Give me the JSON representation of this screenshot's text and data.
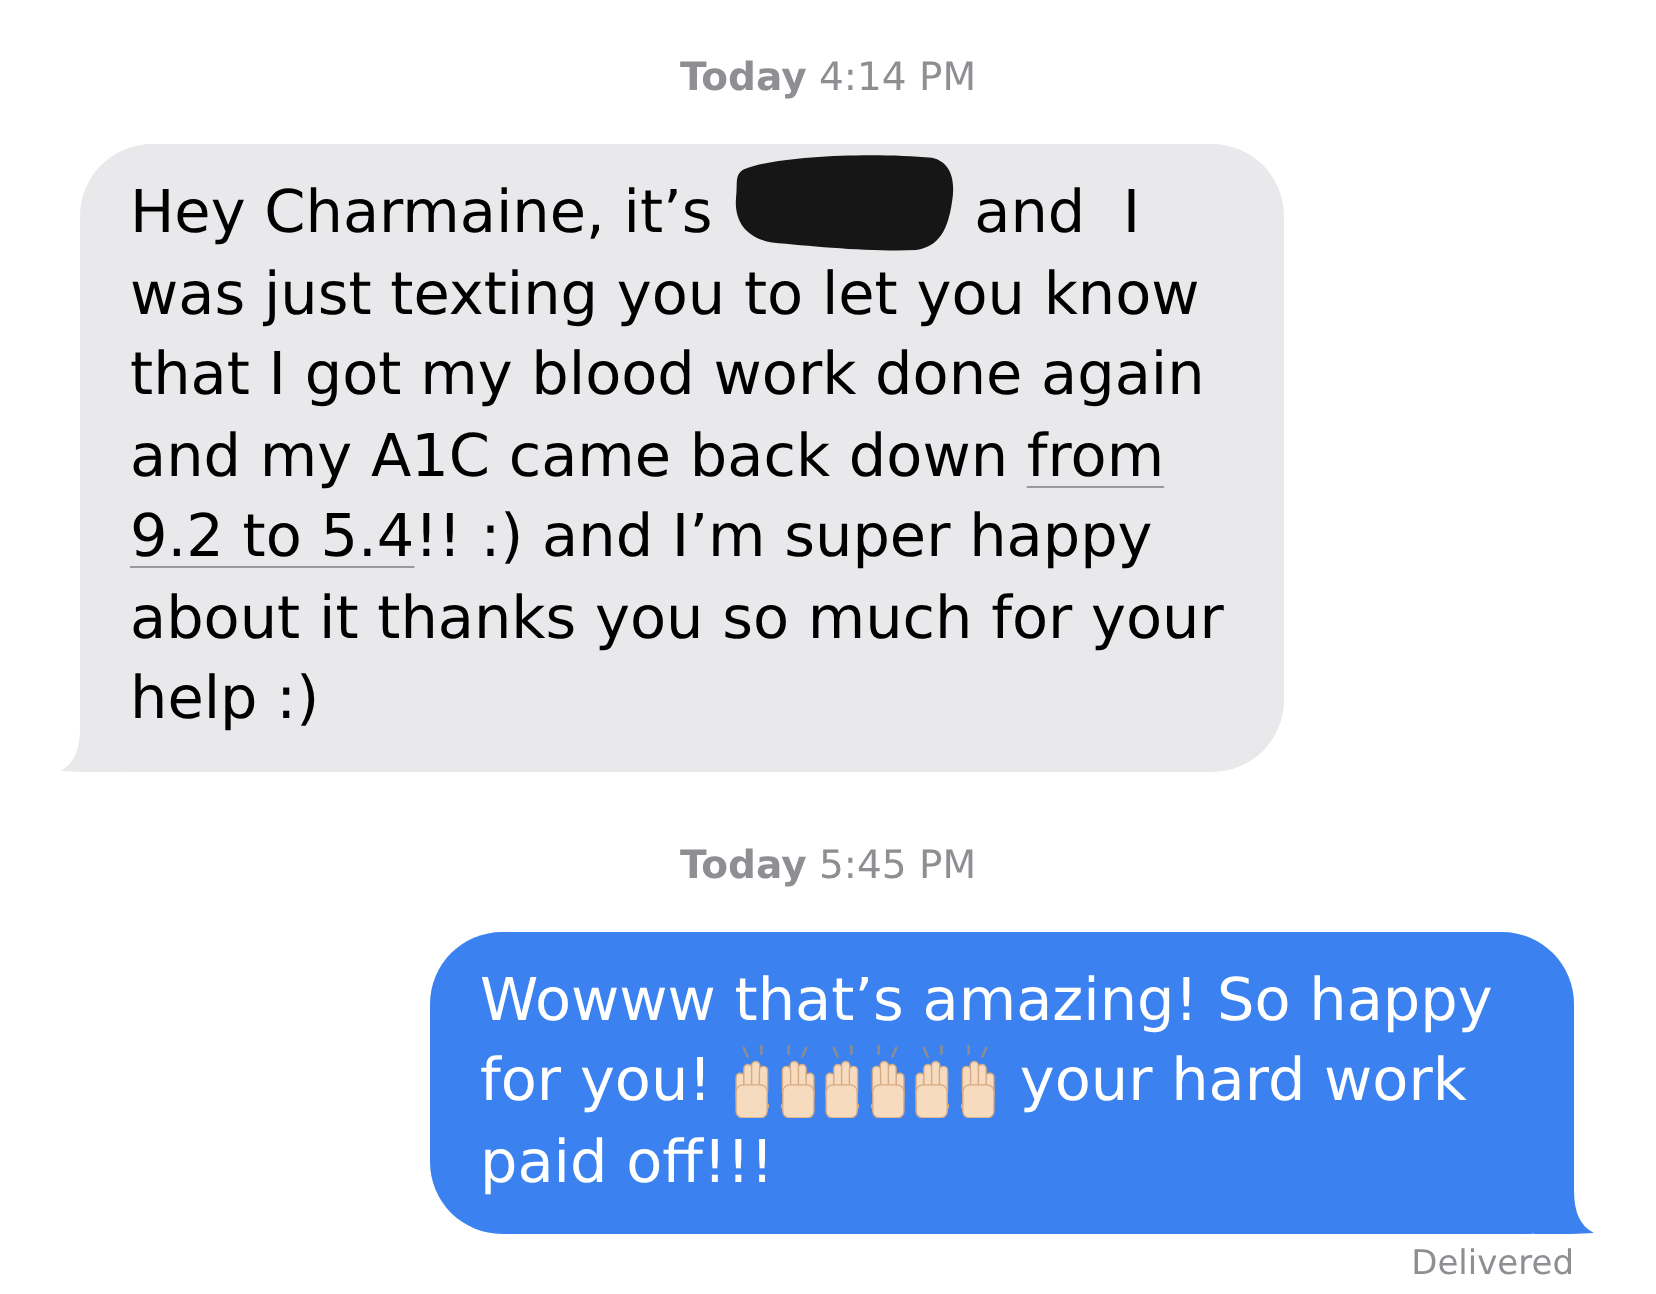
{
  "conversation": [
    {
      "timestamp": "**Today** 4:14 PM",
      "message": {
        "kind": "incoming",
        "lines": [
          [
            {
              "kind": "text",
              "text": "Hey Charmaine, it’s"
            },
            {
              "kind": "redacted"
            },
            {
              "kind": "text",
              "text": "and  I"
            }
          ],
          [
            {
              "kind": "text",
              "text": "was just texting you to let you know"
            }
          ],
          [
            {
              "kind": "text",
              "text": "that I got my blood work done again"
            }
          ],
          [
            {
              "kind": "text",
              "text": "and my A1C came back down "
            },
            {
              "kind": "link",
              "text": "from"
            }
          ],
          [
            {
              "kind": "link",
              "text": "9.2 to 5.4"
            },
            {
              "kind": "text",
              "text": "!! :) and I’m super happy"
            }
          ],
          [
            {
              "kind": "text",
              "text": "about it thanks you so much for your"
            }
          ],
          [
            {
              "kind": "text",
              "text": "help :)"
            }
          ]
        ]
      }
    },
    {
      "timestamp": "**Today** 5:45 PM",
      "message": {
        "kind": "outgoing",
        "lines": [
          [
            {
              "kind": "text",
              "text": "Wowww that’s amazing! So happy"
            }
          ],
          [
            {
              "kind": "text",
              "text": "for you!"
            },
            {
              "kind": "emoji"
            },
            {
              "kind": "emoji"
            },
            {
              "kind": "emoji"
            },
            {
              "kind": "text",
              "text": "your hard work"
            }
          ],
          [
            {
              "kind": "text",
              "text": "paid off!!!"
            }
          ]
        ],
        "status": "Delivered"
      }
    }
  ]
}
